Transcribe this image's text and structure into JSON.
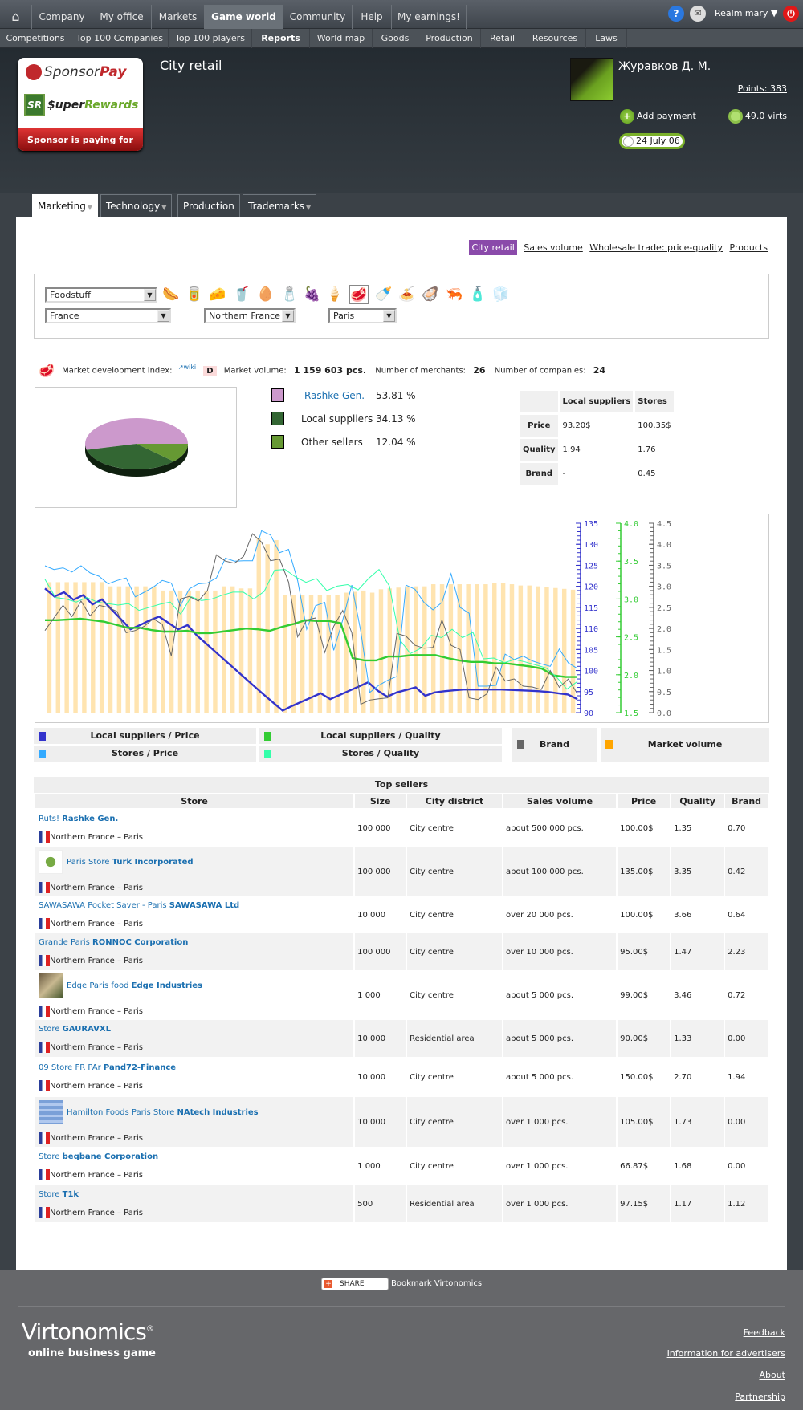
{
  "topnav": {
    "items": [
      "Company",
      "My office",
      "Markets",
      "Game world",
      "Community",
      "Help",
      "My earnings!"
    ],
    "active": "Game world",
    "realm_label": "Realm mary"
  },
  "subnav": {
    "items": [
      "Competitions",
      "Top 100 Companies",
      "Top 100 players",
      "Reports",
      "World map",
      "Goods",
      "Production",
      "Retail",
      "Resources",
      "Laws"
    ],
    "active": "Reports"
  },
  "sponsor": {
    "line1a": "Sponsor",
    "line1b": "Pay",
    "line2a": "$uper",
    "line2b": "Rewards",
    "line3": "Sponsor is paying for you!"
  },
  "header": {
    "page_title": "City retail",
    "username": "Журавков Д. М.",
    "points": "Points: 383",
    "add_payment": "Add payment",
    "virts": "49.0 virts",
    "date": "24 July 06"
  },
  "tabs": [
    {
      "label": "Marketing",
      "dropdown": true
    },
    {
      "label": "Technology",
      "dropdown": true
    },
    {
      "label": "Production",
      "dropdown": false
    },
    {
      "label": "Trademarks",
      "dropdown": true
    }
  ],
  "report_links": [
    "City retail",
    "Sales volume",
    "Wholesale trade: price-quality",
    "Products"
  ],
  "filters": {
    "category": "Foodstuff",
    "country": "France",
    "region": "Northern France",
    "city": "Paris",
    "products": [
      "sausages",
      "canned food",
      "cheese",
      "yogurt",
      "eggs",
      "flour",
      "grapes",
      "ice cream",
      "meat",
      "milk",
      "pasta",
      "seafood",
      "shrimp",
      "spices",
      "sugar"
    ],
    "selected_product": "meat"
  },
  "market": {
    "dev_index_label": "Market development index:",
    "wiki": "wiki",
    "dev_index": "D",
    "volume_label": "Market volume:",
    "volume": "1 159 603 pcs.",
    "merchants_label": "Number of merchants:",
    "merchants": "26",
    "companies_label": "Number of companies:",
    "companies": "24"
  },
  "share": {
    "legend": [
      {
        "label": "Rashke Gen.",
        "pct": "53.81 %",
        "color": "#cc99cc",
        "link": true
      },
      {
        "label": "Local suppliers",
        "pct": "34.13 %",
        "color": "#336633",
        "link": false
      },
      {
        "label": "Other sellers",
        "pct": "12.04 %",
        "color": "#669933",
        "link": false
      }
    ]
  },
  "stats": {
    "cols": [
      "Local suppliers",
      "Stores"
    ],
    "rows": [
      {
        "label": "Price",
        "local": "93.20$",
        "stores": "100.35$"
      },
      {
        "label": "Quality",
        "local": "1.94",
        "stores": "1.76"
      },
      {
        "label": "Brand",
        "local": "-",
        "stores": "0.45"
      }
    ]
  },
  "chart_legend": [
    {
      "label": "Local suppliers / Price",
      "color": "#3333cc"
    },
    {
      "label": "Local suppliers / Quality",
      "color": "#33cc33"
    },
    {
      "label": "Brand",
      "color": "#666666"
    },
    {
      "label": "Market volume",
      "color": "#ffa500"
    },
    {
      "label": "Stores / Price",
      "color": "#33aaff"
    },
    {
      "label": "Stores / Quality",
      "color": "#33ffaa"
    }
  ],
  "chart_data": [
    {
      "type": "pie",
      "title": "",
      "categories": [
        "Rashke Gen.",
        "Local suppliers",
        "Other sellers"
      ],
      "values": [
        53.81,
        34.13,
        12.04
      ],
      "colors": [
        "#cc99cc",
        "#336633",
        "#669933"
      ]
    },
    {
      "type": "line",
      "title": "",
      "axes": {
        "price": {
          "range": [
            90,
            135
          ],
          "ticks": [
            90,
            95,
            100,
            105,
            110,
            115,
            120,
            125,
            130,
            135
          ],
          "color": "#3333cc"
        },
        "quality": {
          "range": [
            1.5,
            4.0
          ],
          "ticks": [
            1.5,
            2.0,
            2.5,
            3.0,
            3.5,
            4.0
          ],
          "color": "#33cc33"
        },
        "brand": {
          "range": [
            0.0,
            4.5
          ],
          "ticks": [
            0.0,
            0.5,
            1.0,
            1.5,
            2.0,
            2.5,
            3.0,
            3.5,
            4.0,
            4.5
          ],
          "color": "#666666"
        }
      },
      "series": [
        {
          "name": "Local suppliers / Price",
          "axis": "price",
          "color": "#3333cc",
          "values": [
            119.5,
            117.6,
            118.6,
            116.8,
            117.9,
            115.7,
            116.9,
            114.5,
            112.2,
            109.8,
            110.8,
            111.9,
            112.8,
            111.3,
            109.8,
            110.8,
            108.3,
            106.3,
            104.3,
            102.3,
            100.3,
            98.3,
            96.3,
            94.3,
            92.4,
            90.5,
            91.6,
            92.6,
            93.6,
            94.6,
            93.2,
            94.2,
            95.2,
            96.2,
            97.2,
            95.2,
            93.8,
            94.8,
            95.4,
            96.0,
            94.0,
            94.8,
            95.1,
            95.3,
            95.5,
            95.5,
            95.5,
            95.5,
            95.5,
            95.4,
            95.3,
            95.2,
            95.1,
            94.9,
            94.6,
            94.3,
            93.2
          ]
        },
        {
          "name": "Stores / Price",
          "axis": "price",
          "color": "#33aaff",
          "values": [
            124.9,
            124.0,
            124.4,
            123.4,
            124.9,
            123.2,
            122.4,
            120.6,
            121.4,
            122.0,
            117.5,
            118.6,
            119.8,
            121.4,
            120.8,
            115.4,
            119.4,
            120.6,
            120.8,
            122.0,
            126.7,
            126.0,
            126.1,
            126.1,
            133.2,
            132.2,
            128.0,
            128.8,
            121.4,
            109.8,
            115.4,
            116.2,
            104.8,
            112.0,
            120.3,
            109.3,
            94.8,
            96.5,
            97.7,
            98.6,
            120.3,
            119.3,
            116.2,
            114.4,
            116.2,
            123.0,
            115.0,
            113.6,
            96.3,
            96.3,
            96.5,
            103.9,
            102.6,
            103.4,
            102.3,
            101.6,
            101.0,
            105.1,
            101.8,
            100.5
          ]
        },
        {
          "name": "Local suppliers / Quality",
          "axis": "quality",
          "color": "#33cc33",
          "values": [
            2.72,
            2.72,
            2.73,
            2.74,
            2.72,
            2.7,
            2.66,
            2.62,
            2.62,
            2.59,
            2.57,
            2.57,
            2.58,
            2.55,
            2.55,
            2.57,
            2.59,
            2.61,
            2.6,
            2.58,
            2.63,
            2.67,
            2.72,
            2.71,
            2.71,
            2.68,
            2.22,
            2.19,
            2.19,
            2.24,
            2.24,
            2.26,
            2.26,
            2.26,
            2.22,
            2.19,
            2.17,
            2.17,
            2.15,
            2.15,
            2.13,
            2.11,
            2.08,
            1.99,
            1.97,
            1.97
          ]
        },
        {
          "name": "Stores / Quality",
          "axis": "quality",
          "color": "#33ffaa",
          "values": [
            3.26,
            3.02,
            3.0,
            2.96,
            3.02,
            2.96,
            2.94,
            2.92,
            2.94,
            2.85,
            2.89,
            2.93,
            2.96,
            2.8,
            3.03,
            2.98,
            3.0,
            3.05,
            3.09,
            3.09,
            3.0,
            3.1,
            3.38,
            3.39,
            3.29,
            3.22,
            3.27,
            3.11,
            3.17,
            3.19,
            3.12,
            3.27,
            3.39,
            3.17,
            2.46,
            2.28,
            2.35,
            2.52,
            2.49,
            2.6,
            2.49,
            2.56,
            2.21,
            2.22,
            2.16,
            2.2,
            2.17,
            2.13,
            2.09,
            1.97,
            1.81,
            1.91
          ]
        },
        {
          "name": "Brand",
          "axis": "brand",
          "color": "#666666",
          "values": [
            1.95,
            2.25,
            2.55,
            2.28,
            2.65,
            2.3,
            2.55,
            2.5,
            2.4,
            1.9,
            1.95,
            2.05,
            2.23,
            2.1,
            1.35,
            2.7,
            2.76,
            2.65,
            2.9,
            3.75,
            3.6,
            3.55,
            3.71,
            4.25,
            4.05,
            3.61,
            3.65,
            3.1,
            1.8,
            2.2,
            2.25,
            1.43,
            2.05,
            2.43,
            1.9,
            0.2,
            0.3,
            0.33,
            0.35,
            1.88,
            1.82,
            1.6,
            1.53,
            1.55,
            2.2,
            1.6,
            1.5,
            0.35,
            0.31,
            0.45,
            1.08,
            0.75,
            0.8,
            0.63,
            0.61,
            0.55,
            1.0,
            0.6,
            0.8,
            0.45
          ]
        },
        {
          "name": "Market volume",
          "type": "bar",
          "color": "#ffe4b0",
          "values": [
            3.1,
            3.1,
            3.1,
            3.1,
            3.1,
            3.1,
            3.1,
            3.0,
            3.0,
            3.0,
            3.0,
            3.0,
            3.0,
            2.9,
            2.9,
            2.9,
            2.9,
            2.9,
            2.9,
            2.9,
            3.0,
            3.0,
            2.95,
            2.95,
            4.15,
            4.0,
            4.1,
            2.8,
            2.8,
            2.8,
            2.8,
            2.8,
            2.8,
            2.8,
            2.85,
            2.87,
            2.9,
            2.85,
            2.93,
            2.95,
            2.97,
            3.0,
            3.0,
            3.0,
            3.05,
            3.05,
            3.05,
            3.05,
            3.05,
            3.05,
            3.05,
            3.07,
            3.07,
            3.05,
            3.02,
            3.02,
            3.0,
            2.98,
            2.96,
            2.94,
            2.92
          ]
        }
      ]
    }
  ],
  "sellers": {
    "title": "Top sellers",
    "columns": [
      "Store",
      "Size",
      "City district",
      "Sales volume",
      "Price",
      "Quality",
      "Brand"
    ],
    "rows": [
      {
        "store": "Ruts!",
        "company": "Rashke Gen.",
        "location": "Northern France – Paris",
        "logo": "",
        "size": "100 000",
        "district": "City centre",
        "sales": "about 500 000 pcs.",
        "price": "100.00$",
        "quality": "1.35",
        "brand": "0.70"
      },
      {
        "store": "Paris Store",
        "company": "Turk Incorporated",
        "location": "Northern France – Paris",
        "logo": "gear-logo",
        "size": "100 000",
        "district": "City centre",
        "sales": "about 100 000 pcs.",
        "price": "135.00$",
        "quality": "3.35",
        "brand": "0.42"
      },
      {
        "store": "SAWASAWA Pocket Saver - Paris",
        "company": "SAWASAWA Ltd",
        "location": "Northern France – Paris",
        "logo": "",
        "size": "10 000",
        "district": "City centre",
        "sales": "over 20 000 pcs.",
        "price": "100.00$",
        "quality": "3.66",
        "brand": "0.64"
      },
      {
        "store": "Grande Paris",
        "company": "RONNOC Corporation",
        "location": "Northern France – Paris",
        "logo": "",
        "size": "100 000",
        "district": "City centre",
        "sales": "over 10 000 pcs.",
        "price": "95.00$",
        "quality": "1.47",
        "brand": "2.23"
      },
      {
        "store": "Edge Paris food",
        "company": "Edge Industries",
        "location": "Northern France – Paris",
        "logo": "bird-logo",
        "size": "1 000",
        "district": "City centre",
        "sales": "about 5 000 pcs.",
        "price": "99.00$",
        "quality": "3.46",
        "brand": "0.72"
      },
      {
        "store": "Store",
        "company": "GAURAVXL",
        "location": "Northern France – Paris",
        "logo": "",
        "size": "10 000",
        "district": "Residential area",
        "sales": "about 5 000 pcs.",
        "price": "90.00$",
        "quality": "1.33",
        "brand": "0.00"
      },
      {
        "store": "09 Store FR PAr",
        "company": "Pand72-Finance",
        "location": "Northern France – Paris",
        "logo": "",
        "size": "10 000",
        "district": "City centre",
        "sales": "about 5 000 pcs.",
        "price": "150.00$",
        "quality": "2.70",
        "brand": "1.94"
      },
      {
        "store": "Hamilton Foods Paris Store",
        "company": "NAtech Industries",
        "location": "Northern France – Paris",
        "logo": "natech-logo",
        "size": "10 000",
        "district": "City centre",
        "sales": "over 1 000 pcs.",
        "price": "105.00$",
        "quality": "1.73",
        "brand": "0.00"
      },
      {
        "store": "Store",
        "company": "beqbane Corporation",
        "location": "Northern France – Paris",
        "logo": "",
        "size": "1 000",
        "district": "City centre",
        "sales": "over 1 000 pcs.",
        "price": "66.87$",
        "quality": "1.68",
        "brand": "0.00"
      },
      {
        "store": "Store",
        "company": "T1k",
        "location": "Northern France – Paris",
        "logo": "",
        "size": "500",
        "district": "Residential area",
        "sales": "over 1 000 pcs.",
        "price": "97.15$",
        "quality": "1.17",
        "brand": "1.12"
      }
    ]
  },
  "footer": {
    "share_label": "SHARE",
    "bookmark": "Bookmark Virtonomics",
    "logo": "Virtonomics",
    "logo_mark": "®",
    "tagline": "online business game",
    "links": [
      "Feedback",
      "Information for advertisers",
      "About",
      "Partnership"
    ]
  }
}
